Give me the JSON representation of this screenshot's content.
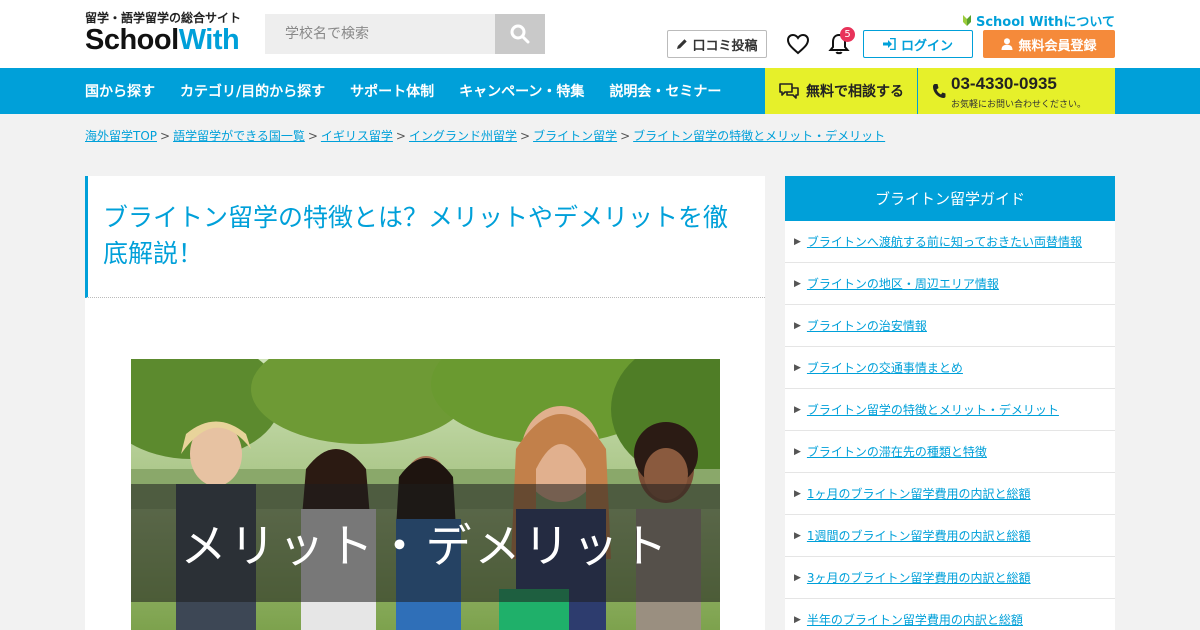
{
  "header": {
    "logo_tagline": "留学・語学留学の総合サイト",
    "logo_school": "Scho",
    "logo_o": "o",
    "logo_l": "l",
    "logo_with": "With",
    "search_placeholder": "学校名で検索",
    "about_link": "School Withについて",
    "review_button": "口コミ投稿",
    "notification_count": "5",
    "login_button": "ログイン",
    "register_button": "無料会員登録"
  },
  "nav": {
    "items": [
      {
        "label": "国から探す"
      },
      {
        "label": "カテゴリ/目的から探す"
      },
      {
        "label": "サポート体制"
      },
      {
        "label": "キャンペーン・特集"
      },
      {
        "label": "説明会・セミナー"
      }
    ],
    "consult_button": "無料で相談する",
    "phone_number": "03-4330-0935",
    "phone_note": "お気軽にお問い合わせください。"
  },
  "breadcrumb": [
    {
      "label": "海外留学TOP"
    },
    {
      "label": "語学留学ができる国一覧"
    },
    {
      "label": "イギリス留学"
    },
    {
      "label": "イングランド州留学"
    },
    {
      "label": "ブライトン留学"
    },
    {
      "label": "ブライトン留学の特徴とメリット・デメリット"
    }
  ],
  "article": {
    "title": "ブライトン留学の特徴とは？メリットやデメリットを徹底解説！",
    "hero_caption": "メリット・デメリット"
  },
  "sidebar": {
    "title": "ブライトン留学ガイド",
    "items": [
      {
        "label": "ブライトンへ渡航する前に知っておきたい両替情報"
      },
      {
        "label": "ブライトンの地区・周辺エリア情報"
      },
      {
        "label": "ブライトンの治安情報"
      },
      {
        "label": "ブライトンの交通事情まとめ"
      },
      {
        "label": "ブライトン留学の特徴とメリット・デメリット"
      },
      {
        "label": "ブライトンの滞在先の種類と特徴"
      },
      {
        "label": "1ヶ月のブライトン留学費用の内訳と総額"
      },
      {
        "label": "1週間のブライトン留学費用の内訳と総額"
      },
      {
        "label": "3ヶ月のブライトン留学費用の内訳と総額"
      },
      {
        "label": "半年のブライトン留学費用の内訳と総額"
      }
    ]
  },
  "colors": {
    "brand_blue": "#00a0d9",
    "accent_orange": "#f58a3a",
    "highlight_yellow": "#e6f02a",
    "badge_red": "#e8335a"
  },
  "icons": [
    "search-icon",
    "leaf-icon",
    "pencil-icon",
    "heart-icon",
    "bell-icon",
    "login-icon",
    "user-icon",
    "chat-icon",
    "phone-icon",
    "arrow-right-icon"
  ]
}
